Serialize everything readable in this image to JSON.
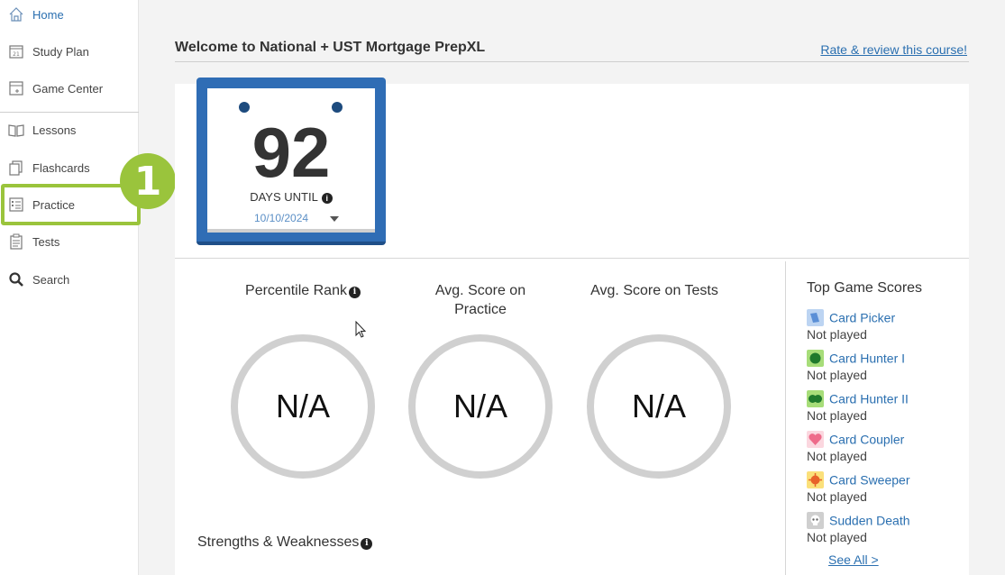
{
  "sidebar": {
    "items": [
      {
        "label": "Home",
        "icon": "home-icon"
      },
      {
        "label": "Study Plan",
        "icon": "calendar-icon"
      },
      {
        "label": "Game Center",
        "icon": "game-center-icon"
      },
      {
        "label": "Lessons",
        "icon": "book-icon"
      },
      {
        "label": "Flashcards",
        "icon": "flashcards-icon"
      },
      {
        "label": "Practice",
        "icon": "checklist-icon"
      },
      {
        "label": "Tests",
        "icon": "clipboard-icon"
      },
      {
        "label": "Search",
        "icon": "search-icon"
      }
    ],
    "active_color": "#2a6fb0",
    "callout_number": "1",
    "highlight_color": "#9ac43c"
  },
  "header": {
    "welcome": "Welcome to National + UST Mortgage PrepXL",
    "rate_link": "Rate & review this course!"
  },
  "calendar": {
    "days": "92",
    "label": "DAYS UNTIL",
    "date": "10/10/2024",
    "frame_color": "#2f6db5"
  },
  "stats": [
    {
      "title": "Percentile Rank",
      "value": "N/A"
    },
    {
      "title": "Avg. Score on Practice",
      "value": "N/A"
    },
    {
      "title": "Avg. Score on Tests",
      "value": "N/A"
    }
  ],
  "strengths_title": "Strengths & Weaknesses",
  "games": {
    "title": "Top Game Scores",
    "items": [
      {
        "name": "Card Picker",
        "score": "Not played",
        "icon": "card-picker-icon",
        "color": "#5b8fd6"
      },
      {
        "name": "Card Hunter I",
        "score": "Not played",
        "icon": "card-hunter-icon",
        "color": "#2e9e3e"
      },
      {
        "name": "Card Hunter II",
        "score": "Not played",
        "icon": "card-hunter-ii-icon",
        "color": "#2e9e3e"
      },
      {
        "name": "Card Coupler",
        "score": "Not played",
        "icon": "heart-icon",
        "color": "#ee6b8a"
      },
      {
        "name": "Card Sweeper",
        "score": "Not played",
        "icon": "sweeper-icon",
        "color": "#f0a020"
      },
      {
        "name": "Sudden Death",
        "score": "Not played",
        "icon": "skull-icon",
        "color": "#9a9a9a"
      }
    ],
    "see_all": "See All >"
  }
}
